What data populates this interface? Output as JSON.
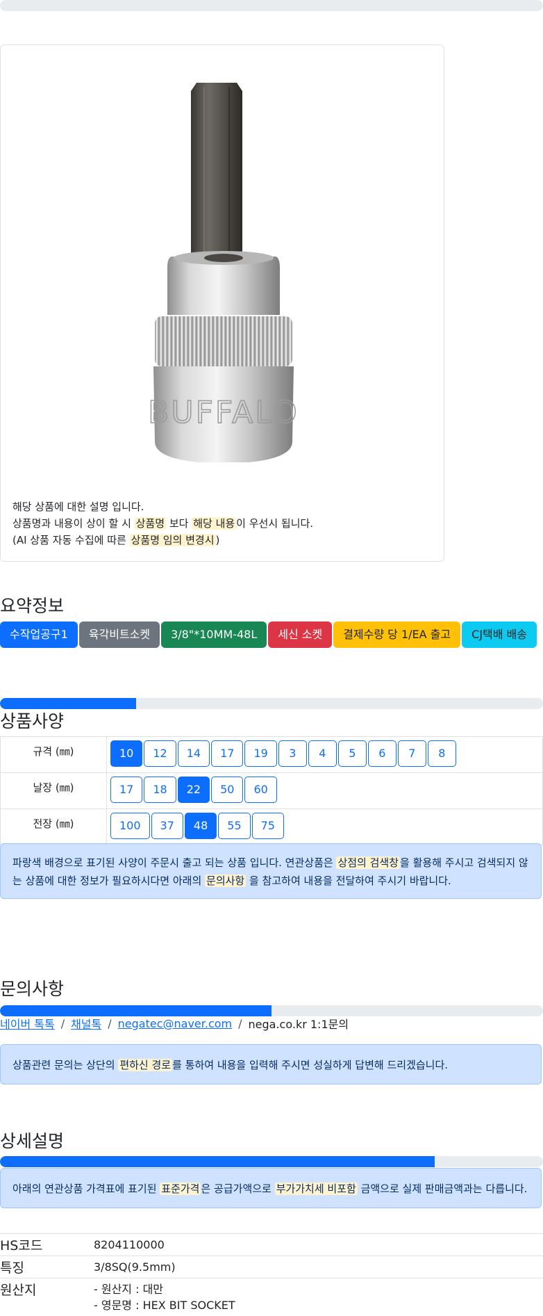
{
  "progress": {
    "top_bar": 0,
    "spec_bar": 0.25,
    "inquiry_bar": 0.5,
    "detail_bar": 0.8
  },
  "image_box": {
    "product_image": "hex bit socket product photo",
    "engraving": "BUFFALO",
    "desc_line1": "해당 상품에 대한 설명 입니다.",
    "desc_line2_a": "상품명과 내용이 상이 할 시 ",
    "desc_line2_hl1": "상품명",
    "desc_line2_b": " 보다 ",
    "desc_line2_hl2": "해당 내용",
    "desc_line2_c": "이 우선시 됩니다.",
    "desc_line3_a": "(AI 상품 자동 수집에 따른 ",
    "desc_line3_hl": "상품명 임의 변경시",
    "desc_line3_b": ")"
  },
  "summary": {
    "title": "요약정보",
    "badges": [
      {
        "label": "수작업공구1",
        "color": "#0d6efd"
      },
      {
        "label": "육각비트소켓",
        "color": "#6c757d"
      },
      {
        "label": "3/8\"*10MM-48L",
        "color": "#198754"
      },
      {
        "label": "세신 소켓",
        "color": "#dc3545"
      },
      {
        "label": "결제수량 당 1/EA 출고",
        "color": "#ffc107"
      },
      {
        "label": "CJ택배 배송",
        "color": "#0dcaf0"
      }
    ]
  },
  "spec": {
    "title": "상품사양",
    "rows": [
      {
        "label": "규격 (㎜)",
        "options": [
          "10",
          "12",
          "14",
          "17",
          "19",
          "3",
          "4",
          "5",
          "6",
          "7",
          "8"
        ],
        "selected": "10"
      },
      {
        "label": "날장 (㎜)",
        "options": [
          "17",
          "18",
          "22",
          "50",
          "60"
        ],
        "selected": "22"
      },
      {
        "label": "전장 (㎜)",
        "options": [
          "100",
          "37",
          "48",
          "55",
          "75"
        ],
        "selected": "48"
      }
    ],
    "note_a": "파랑색 배경으로 표기된 사양이 주문시 출고 되는 상품 입니다. 연관상품은 ",
    "note_hl1": "상점의 검색창",
    "note_b": "을 활용해 주시고 검색되지 않는 상품에 대한 정보가 필요하시다면 아래의 ",
    "note_hl2": "문의사항",
    "note_c": " 을 참고하여 내용을 전달하여 주시기 바랍니다."
  },
  "inquiry": {
    "title": "문의사항",
    "links": [
      "네이버 톡톡",
      "채널톡",
      "negatec@naver.com"
    ],
    "plain": "nega.co.kr 1:1문의",
    "sep": "/",
    "note_a": "상품관련 문의는 상단의 ",
    "note_hl": "편하신 경로",
    "note_b": "를 통하여 내용을 입력해 주시면 성실하게 답변해 드리겠습니다."
  },
  "detail": {
    "title": "상세설명",
    "note_a": "아래의 연관상품 가격표에 표기된 ",
    "note_hl1": "표준가격",
    "note_b": "은 공급가액으로 ",
    "note_hl2": "부가가치세 비포함",
    "note_c": " 금액으로 실제 판매금액과는 다릅니다."
  },
  "info": {
    "hs_label": "HS코드",
    "hs_value": "8204110000",
    "feat_label": "특징",
    "feat_value": "3/8SQ(9.5mm)",
    "origin_label": "원산지",
    "origin_line1": "- 원산지 : 대만",
    "origin_line2": "- 영문명 : HEX BIT SOCKET"
  }
}
